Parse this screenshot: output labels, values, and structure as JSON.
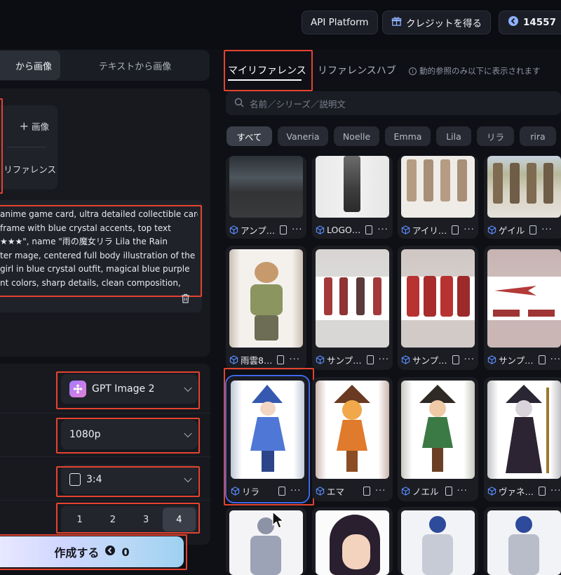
{
  "topbar": {
    "api_platform": "API Platform",
    "credits_button": "クレジットを得る",
    "credit_balance": "14557",
    "separator": "|"
  },
  "mode_tabs": {
    "image_to_image": "から画像",
    "text_to_image": "テキストから画像"
  },
  "upload": {
    "image_label": "画像",
    "reference_label": "リファレンス"
  },
  "prompt": {
    "lines": [
      "anime game card, ultra detailed collectible card",
      " frame with blue crystal accents, top text",
      "★★★\", name \"雨の魔女リラ Lila the Rain",
      "ter mage, centered full body illustration of the",
      " girl in blue crystal outfit, magical blue purple",
      "nt colors, sharp details, clean composition,"
    ]
  },
  "settings": {
    "model": "GPT Image 2",
    "resolution": "1080p",
    "aspect_ratio": "3:4",
    "counts": [
      "1",
      "2",
      "3",
      "4"
    ],
    "selected_count": "4"
  },
  "create": {
    "label": "作成する",
    "cost": "0"
  },
  "references": {
    "tabs": {
      "mine": "マイリファレンス",
      "hub": "リファレンスハブ"
    },
    "notice": "動的参照のみ以下に表示されます",
    "search_placeholder": "名前／シリーズ／説明文",
    "filters": [
      "すべて",
      "Vaneria",
      "Noelle",
      "Emma",
      "Lila",
      "リラ",
      "rira"
    ],
    "rows": [
      [
        "アンプ…",
        "LOGO…",
        "アイリ…",
        "ゲイル"
      ],
      [
        "雨雲8…",
        "サンプ…",
        "サンプ…",
        "サンプ…"
      ],
      [
        "リラ",
        "エマ",
        "ノエル",
        "ヴァネ…"
      ]
    ]
  },
  "colors": {
    "accent_red": "#e5432f",
    "selected_blue": "#3f6ae8",
    "background": "#0b0d12"
  }
}
